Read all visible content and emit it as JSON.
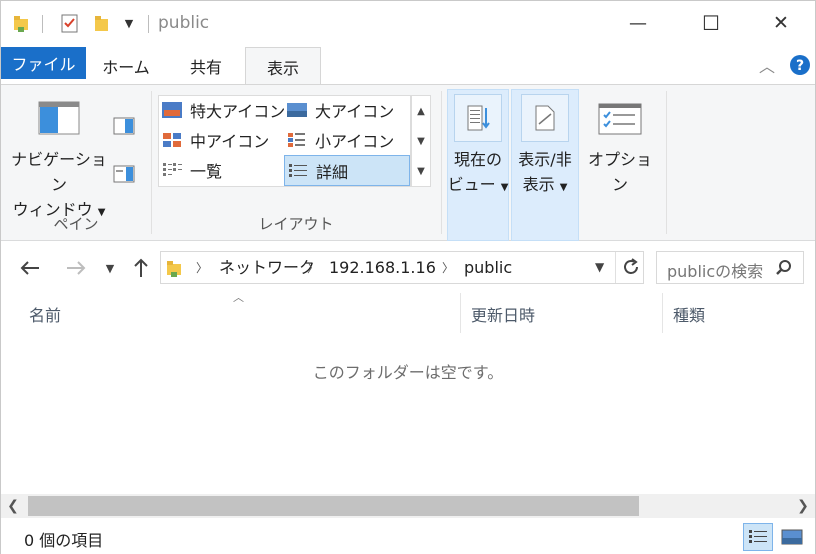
{
  "window": {
    "title": "public",
    "controls": {
      "minimize": "—",
      "maximize": "☐",
      "close": "✕"
    }
  },
  "ribbon_tabs": [
    {
      "label": "ファイル"
    },
    {
      "label": "ホーム"
    },
    {
      "label": "共有"
    },
    {
      "label": "表示"
    }
  ],
  "ribbon": {
    "pane_group": {
      "nav_pane_line1": "ナビゲーション",
      "nav_pane_line2": "ウィンドウ",
      "label": "ペイン"
    },
    "layout_group": {
      "items": [
        {
          "label": "特大アイコン"
        },
        {
          "label": "大アイコン"
        },
        {
          "label": "中アイコン"
        },
        {
          "label": "小アイコン"
        },
        {
          "label": "一覧"
        },
        {
          "label": "詳細"
        }
      ],
      "selected": "詳細",
      "label": "レイアウト"
    },
    "current_view": {
      "line1": "現在の",
      "line2": "ビュー"
    },
    "show_hide": {
      "line1": "表示/非",
      "line2": "表示"
    },
    "options": {
      "label": "オプション"
    }
  },
  "address_bar": {
    "crumbs": [
      "ネットワーク",
      "192.168.1.16",
      "public"
    ]
  },
  "search": {
    "placeholder": "publicの検索"
  },
  "columns": [
    "名前",
    "更新日時",
    "種類"
  ],
  "empty_message": "このフォルダーは空です。",
  "status": {
    "item_count": "0 個の項目"
  },
  "colors": {
    "accent": "#1a6fc9",
    "selection": "#cce4f7",
    "help": "#1a6fc9"
  }
}
